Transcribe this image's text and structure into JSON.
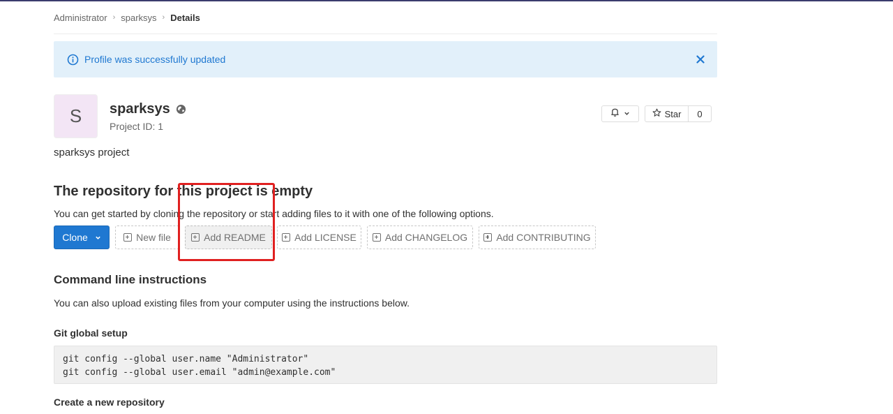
{
  "breadcrumb": {
    "items": [
      "Administrator",
      "sparksys"
    ],
    "current": "Details",
    "separator": "›"
  },
  "alert": {
    "message": "Profile was successfully updated",
    "icon": "info-icon",
    "close_icon": "close-icon",
    "color": "#1f78d1",
    "background": "#e2f0fa"
  },
  "project": {
    "avatar_letter": "S",
    "name": "sparksys",
    "visibility_icon": "globe-icon",
    "id_label": "Project ID: 1",
    "description": "sparksys project"
  },
  "actions": {
    "notification_icon": "bell-icon",
    "star_label": "Star",
    "star_count": "0"
  },
  "empty_repo": {
    "title": "The repository for this project is empty",
    "text": "You can get started by cloning the repository or start adding files to it with one of the following options.",
    "clone_label": "Clone",
    "buttons": [
      "New file",
      "Add README",
      "Add LICENSE",
      "Add CHANGELOG",
      "Add CONTRIBUTING"
    ],
    "accent": "#1f78d1",
    "highlight_color": "#e02020"
  },
  "cli": {
    "title": "Command line instructions",
    "text": "You can also upload existing files from your computer using the instructions below.",
    "git_setup_title": "Git global setup",
    "git_setup_lines": [
      "git config --global user.name \"Administrator\"",
      "git config --global user.email \"admin@example.com\""
    ],
    "new_repo_title": "Create a new repository"
  }
}
